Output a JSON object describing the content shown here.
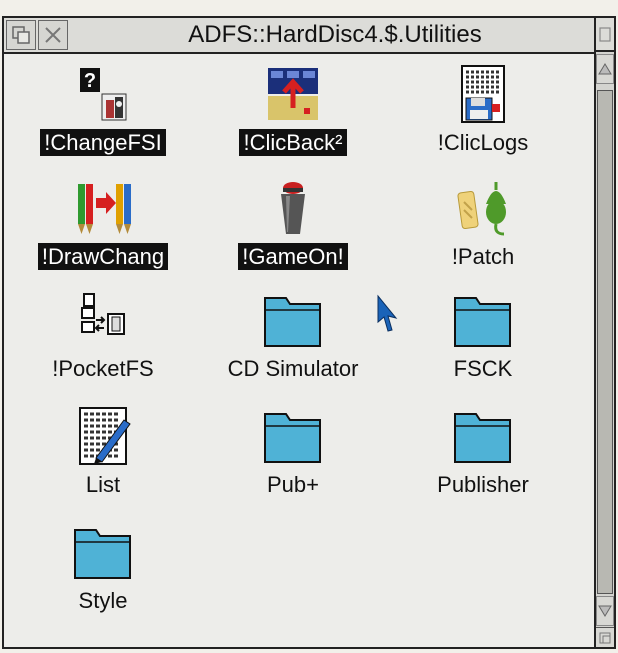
{
  "window": {
    "title": "ADFS::HardDisc4.$.Utilities"
  },
  "items": [
    {
      "label": "!ChangeFSI",
      "selected": true,
      "icon": "changefsi-icon"
    },
    {
      "label": "!ClicBack²",
      "selected": true,
      "icon": "clicback-icon"
    },
    {
      "label": "!ClicLogs",
      "selected": false,
      "icon": "cliclogs-icon"
    },
    {
      "label": "!DrawChang",
      "selected": true,
      "icon": "drawchang-icon"
    },
    {
      "label": "!GameOn!",
      "selected": true,
      "icon": "gameon-icon"
    },
    {
      "label": "!Patch",
      "selected": false,
      "icon": "patch-icon"
    },
    {
      "label": "!PocketFS",
      "selected": false,
      "icon": "pocketfs-icon"
    },
    {
      "label": "CD Simulator",
      "selected": false,
      "icon": "folder-icon"
    },
    {
      "label": "FSCK",
      "selected": false,
      "icon": "folder-icon"
    },
    {
      "label": "List",
      "selected": false,
      "icon": "list-icon"
    },
    {
      "label": "Pub+",
      "selected": false,
      "icon": "folder-icon"
    },
    {
      "label": "Publisher",
      "selected": false,
      "icon": "folder-icon"
    },
    {
      "label": "Style",
      "selected": false,
      "icon": "folder-icon"
    }
  ],
  "colors": {
    "folder": "#4fb2d6",
    "selection": "#111111",
    "window_bg": "#ededea",
    "pointer": "#1a63b8"
  }
}
